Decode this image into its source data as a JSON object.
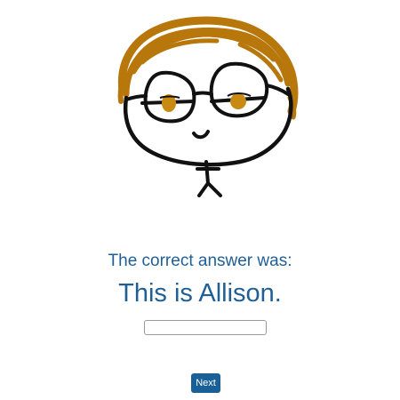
{
  "illustration": {
    "subject": "cartoon-face-with-glasses",
    "hair_color": "#b8770a",
    "eye_color": "#c88a10",
    "line_color": "#111111"
  },
  "result": {
    "prompt": "The correct answer was:",
    "answer": "This is Allison."
  },
  "answer_input": {
    "value": "",
    "placeholder": ""
  },
  "next_button": {
    "label": "Next",
    "color": "#1a5f97"
  },
  "colors": {
    "text_accent": "#1f5f96",
    "background": "#ffffff"
  }
}
